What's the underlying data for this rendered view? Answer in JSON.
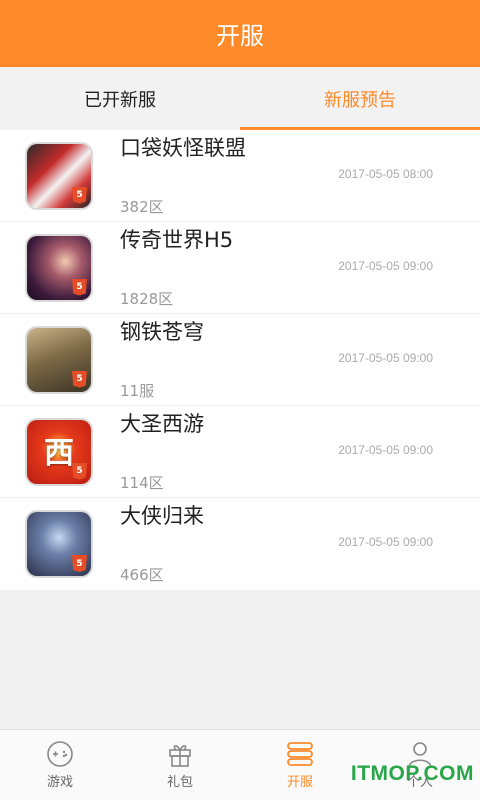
{
  "header": {
    "title": "开服"
  },
  "tabs": [
    {
      "label": "已开新服",
      "active": false
    },
    {
      "label": "新服预告",
      "active": true
    }
  ],
  "games": [
    {
      "name": "口袋妖怪联盟",
      "server": "382区",
      "time": "2017-05-05 08:00",
      "icon": "pokeball-game-icon"
    },
    {
      "name": "传奇世界H5",
      "server": "1828区",
      "time": "2017-05-05 09:00",
      "icon": "legend-world-game-icon"
    },
    {
      "name": "钢铁苍穹",
      "server": "11服",
      "time": "2017-05-05 09:00",
      "icon": "tank-game-icon"
    },
    {
      "name": "大圣西游",
      "server": "114区",
      "time": "2017-05-05 09:00",
      "icon": "journey-west-game-icon"
    },
    {
      "name": "大侠归来",
      "server": "466区",
      "time": "2017-05-05 09:00",
      "icon": "hero-return-game-icon"
    }
  ],
  "badges": {
    "html5": "5",
    "icon4_glyph": "西"
  },
  "bottom_nav": [
    {
      "label": "游戏",
      "icon": "gamepad-icon"
    },
    {
      "label": "礼包",
      "icon": "gift-icon"
    },
    {
      "label": "开服",
      "icon": "server-stack-icon",
      "active": true
    },
    {
      "label": "个人",
      "icon": "person-icon"
    }
  ],
  "watermark": "ITMOP.COM",
  "colors": {
    "accent": "#ff8a2a",
    "watermark": "#2aa64a"
  }
}
